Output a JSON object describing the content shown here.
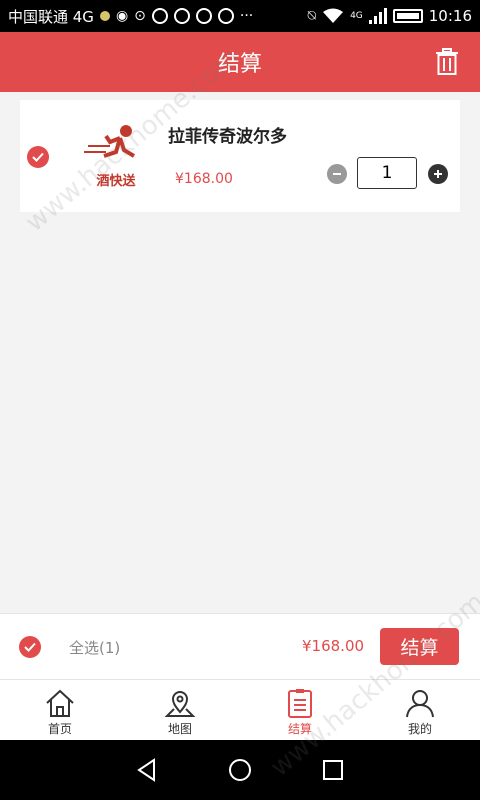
{
  "status_bar": {
    "carrier": "中国联通 4G",
    "network_badge": "4G",
    "time": "10:16",
    "icons": [
      "chat-icon",
      "location-icon",
      "qq-icon",
      "qq-icon",
      "qq-icon",
      "qq-icon",
      "more-icon",
      "mute-icon",
      "wifi-icon",
      "signal-icon",
      "battery-icon"
    ]
  },
  "header": {
    "title": "结算",
    "trash_icon": "trash-icon"
  },
  "cart": {
    "items": [
      {
        "logo_text": "酒快送",
        "name": "拉菲传奇波尔多",
        "price": "¥168.00",
        "quantity": "1",
        "checked": true
      }
    ]
  },
  "checkout_bar": {
    "select_all_label": "全选(1)",
    "total": "¥168.00",
    "checkout_label": "结算"
  },
  "tabs": [
    {
      "label": "首页",
      "icon": "home-icon",
      "active": false
    },
    {
      "label": "地图",
      "icon": "map-pin-icon",
      "active": false
    },
    {
      "label": "结算",
      "icon": "clipboard-icon",
      "active": true
    },
    {
      "label": "我的",
      "icon": "user-icon",
      "active": false
    }
  ],
  "watermark": "www.hackhome.com",
  "colors": {
    "accent": "#e14b4b",
    "background": "#f3f3f3",
    "text_dark": "#222222",
    "text_muted": "#888888"
  }
}
